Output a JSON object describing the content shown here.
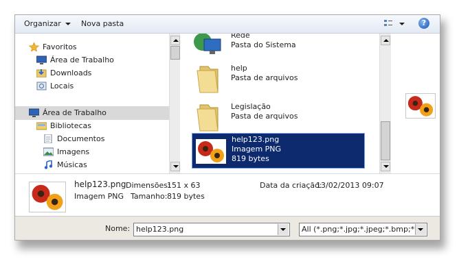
{
  "toolbar": {
    "organize_label": "Organizar",
    "new_folder_label": "Nova pasta",
    "help_icon": "help-icon",
    "view_icon": "view-options-icon"
  },
  "sidebar": {
    "items": [
      {
        "label": "Favoritos",
        "icon": "star-icon"
      },
      {
        "label": "Área de Trabalho",
        "icon": "desktop-icon"
      },
      {
        "label": "Downloads",
        "icon": "downloads-icon"
      },
      {
        "label": "Locais",
        "icon": "recent-places-icon"
      },
      {
        "label": "Área de Trabalho",
        "icon": "desktop-icon",
        "selected": true
      },
      {
        "label": "Bibliotecas",
        "icon": "libraries-icon"
      },
      {
        "label": "Documentos",
        "icon": "document-icon"
      },
      {
        "label": "Imagens",
        "icon": "image-icon"
      },
      {
        "label": "Músicas",
        "icon": "music-icon"
      }
    ]
  },
  "files": [
    {
      "name": "Rede",
      "type": "Pasta do Sistema",
      "icon": "network-icon"
    },
    {
      "name": "help",
      "type": "Pasta de arquivos",
      "icon": "folder-icon"
    },
    {
      "name": "Legislação",
      "type": "Pasta de arquivos",
      "icon": "folder-icon"
    },
    {
      "name": "help123.png",
      "type": "Imagem PNG",
      "size": "819 bytes",
      "icon": "png-thumbnail",
      "selected": true
    }
  ],
  "details": {
    "filename": "help123.png",
    "filetype": "Imagem PNG",
    "dimensions_label": "Dimensões:",
    "dimensions_value": "151 x 63",
    "size_label": "Tamanho:",
    "size_value": "819 bytes",
    "created_label": "Data da criação:",
    "created_value": "13/02/2013 09:07"
  },
  "bottom": {
    "name_label": "Nome:",
    "name_value": "help123.png",
    "filter_value": "All (*.png;*.jpg;*.jpeg;*.bmp;*.ti"
  },
  "colors": {
    "selection": "#0d2a6e",
    "toolbar_top": "#f6f9fd",
    "bottom_bar": "#ece9e3"
  }
}
